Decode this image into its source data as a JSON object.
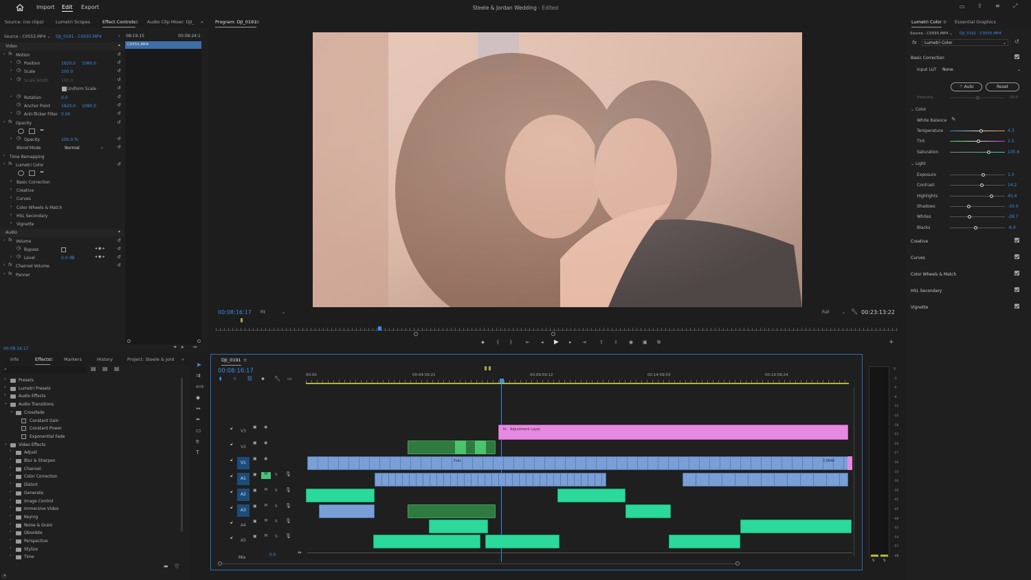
{
  "topbar": {
    "nav": [
      "Import",
      "Edit",
      "Export"
    ],
    "title": "Steele & Jordan Wedding",
    "edited": "- Edited"
  },
  "source_panel": {
    "tabs": [
      "Source: (no clips)",
      "Lumetri Scopes",
      "Effect Controls",
      "Audio Clip Mixer: DJI_0"
    ],
    "active_tab": "Effect Controls",
    "source_sel": "Source - C0555.MP4",
    "clip_sel": "DJI_0191 - C0555.MP4",
    "time_start": "08:19:15",
    "time_end": "00:08:24:1",
    "clip_chip": "C0555.MP4",
    "timecode": "00:08:16:17",
    "rows": [
      {
        "label": "Video",
        "v1": "",
        "v2": ""
      },
      {
        "label": "Motion",
        "v1": "",
        "v2": ""
      },
      {
        "label": "Position",
        "v1": "1920.0",
        "v2": "1080.0"
      },
      {
        "label": "Scale",
        "v1": "100.0",
        "v2": ""
      },
      {
        "label": "Scale Width",
        "v1": "100.0",
        "v2": ""
      },
      {
        "label": "Uniform Scale",
        "v1": "",
        "v2": ""
      },
      {
        "label": "Rotation",
        "v1": "0.0",
        "v2": ""
      },
      {
        "label": "Anchor Point",
        "v1": "1920.0",
        "v2": "1080.0"
      },
      {
        "label": "Anti-flicker Filter",
        "v1": "0.00",
        "v2": ""
      },
      {
        "label": "Opacity",
        "v1": "",
        "v2": ""
      },
      {
        "label": "Opacity",
        "v1": "100.0 %",
        "v2": ""
      },
      {
        "label": "Blend Mode",
        "v1": "Normal",
        "v2": ""
      },
      {
        "label": "Time Remapping",
        "v1": "",
        "v2": ""
      },
      {
        "label": "Lumetri Color",
        "v1": "",
        "v2": ""
      },
      {
        "label": "Basic Correction",
        "v1": "",
        "v2": ""
      },
      {
        "label": "Creative",
        "v1": "",
        "v2": ""
      },
      {
        "label": "Curves",
        "v1": "",
        "v2": ""
      },
      {
        "label": "Color Wheels & Match",
        "v1": "",
        "v2": ""
      },
      {
        "label": "HSL Secondary",
        "v1": "",
        "v2": ""
      },
      {
        "label": "Vignette",
        "v1": "",
        "v2": ""
      },
      {
        "label": "Audio",
        "v1": "",
        "v2": ""
      },
      {
        "label": "Volume",
        "v1": "",
        "v2": ""
      },
      {
        "label": "Bypass",
        "v1": "",
        "v2": ""
      },
      {
        "label": "Level",
        "v1": "0.0 dB",
        "v2": ""
      },
      {
        "label": "Channel Volume",
        "v1": "",
        "v2": ""
      },
      {
        "label": "Panner",
        "v1": "",
        "v2": ""
      }
    ]
  },
  "program": {
    "title": "Program: DJI_0191",
    "timecode": "00:08:16:17",
    "fit": "Fit",
    "full": "Full",
    "duration": "00:23:13:22"
  },
  "lumetri": {
    "tabs": [
      "Lumetri Color",
      "Essential Graphics"
    ],
    "source_sel": "Source - C0555.MP4",
    "clip_sel": "DJI_0191 - C0555.MP4",
    "effect": "Lumetri Color",
    "basic": "Basic Correction",
    "input_lut_label": "Input LUT",
    "input_lut": "None",
    "auto": "Auto",
    "reset": "Reset",
    "intensity_label": "Intensity",
    "intensity": "50.0",
    "color_label": "Color",
    "wb_label": "White Balance",
    "light_label": "Light",
    "color_sliders": [
      {
        "label": "Temperature",
        "value": "4.3",
        "pos": 0.58
      },
      {
        "label": "Tint",
        "value": "1.5",
        "pos": 0.53
      },
      {
        "label": "Saturation",
        "value": "135.6",
        "pos": 0.71
      }
    ],
    "light_sliders": [
      {
        "label": "Exposure",
        "value": "1.0",
        "pos": 0.61
      },
      {
        "label": "Contrast",
        "value": "14.2",
        "pos": 0.59
      },
      {
        "label": "Highlights",
        "value": "45.4",
        "pos": 0.76
      },
      {
        "label": "Shadows",
        "value": "-30.0",
        "pos": 0.35
      },
      {
        "label": "Whites",
        "value": "-28.7",
        "pos": 0.36
      },
      {
        "label": "Blacks",
        "value": "-6.9",
        "pos": 0.47
      }
    ],
    "sections": [
      "Creative",
      "Curves",
      "Color Wheels & Match",
      "HSL Secondary",
      "Vignette"
    ]
  },
  "effects_panel": {
    "tabs": [
      "Info",
      "Effects",
      "Markers",
      "History",
      "Project: Steele & Jorda"
    ],
    "active_tab": "Effects",
    "tree": [
      {
        "label": "Presets",
        "indent": 0,
        "kind": "folder"
      },
      {
        "label": "Lumetri Presets",
        "indent": 0,
        "kind": "folder"
      },
      {
        "label": "Audio Effects",
        "indent": 0,
        "kind": "folder"
      },
      {
        "label": "Audio Transitions",
        "indent": 0,
        "kind": "folder"
      },
      {
        "label": "Crossfade",
        "indent": 1,
        "kind": "folder"
      },
      {
        "label": "Constant Gain",
        "indent": 2,
        "kind": "fx"
      },
      {
        "label": "Constant Power",
        "indent": 2,
        "kind": "fx"
      },
      {
        "label": "Exponential Fade",
        "indent": 2,
        "kind": "fx"
      },
      {
        "label": "Video Effects",
        "indent": 0,
        "kind": "folder"
      },
      {
        "label": "Adjust",
        "indent": 1,
        "kind": "folder"
      },
      {
        "label": "Blur & Sharpen",
        "indent": 1,
        "kind": "folder"
      },
      {
        "label": "Channel",
        "indent": 1,
        "kind": "folder"
      },
      {
        "label": "Color Correction",
        "indent": 1,
        "kind": "folder"
      },
      {
        "label": "Distort",
        "indent": 1,
        "kind": "folder"
      },
      {
        "label": "Generate",
        "indent": 1,
        "kind": "folder"
      },
      {
        "label": "Image Control",
        "indent": 1,
        "kind": "folder"
      },
      {
        "label": "Immersive Video",
        "indent": 1,
        "kind": "folder"
      },
      {
        "label": "Keying",
        "indent": 1,
        "kind": "folder"
      },
      {
        "label": "Noise & Grain",
        "indent": 1,
        "kind": "folder"
      },
      {
        "label": "Obsolete",
        "indent": 1,
        "kind": "folder"
      },
      {
        "label": "Perspective",
        "indent": 1,
        "kind": "folder"
      },
      {
        "label": "Stylize",
        "indent": 1,
        "kind": "folder"
      },
      {
        "label": "Time",
        "indent": 1,
        "kind": "folder"
      }
    ]
  },
  "timeline": {
    "tab": "DJI_0191",
    "timecode": "00:08:16:17",
    "ruler": [
      "00:00",
      "00:04:59:21",
      "00:09:59:12",
      "00:14:59:03",
      "00:19:58:24"
    ],
    "tracks": [
      "V3",
      "V2",
      "V1",
      "A1",
      "A2",
      "A3",
      "A4",
      "A5"
    ],
    "mix_label": "Mix",
    "mix_value": "0.0",
    "adjustment_label": "Adjustment Layer",
    "clip_labels": [
      "Folic",
      "C0646"
    ],
    "meter_scale": [
      "0",
      "-3",
      "-6",
      "-9",
      "-12",
      "-15",
      "-18",
      "-21",
      "-24",
      "-27",
      "-30",
      "-33",
      "-36",
      "-39",
      "-42",
      "-45",
      "-48",
      "-51",
      "-54",
      "-57",
      "-dB"
    ],
    "solo_labels": [
      "S",
      "S"
    ]
  },
  "colors": {
    "accent": "#3b8ee8",
    "video_clip": "#7a9fd6",
    "audio_clip": "#2bd99a",
    "adjustment": "#e58ae0"
  }
}
